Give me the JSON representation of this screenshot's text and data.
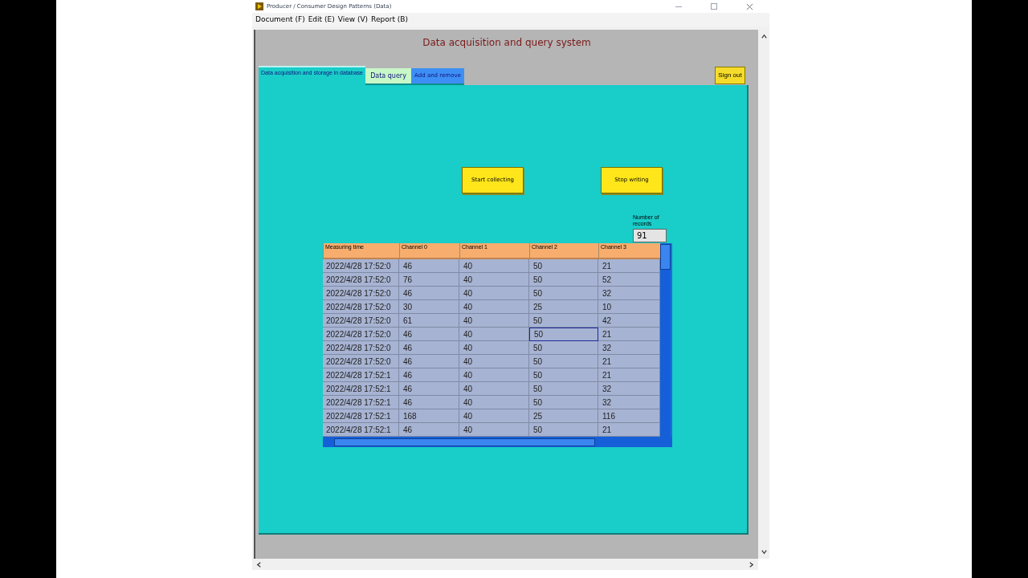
{
  "window": {
    "title": "Producer / Consumer Design Patterns (Data)"
  },
  "menu": [
    "Document (F)",
    "Edit (E)",
    "View (V)",
    "Report (B)"
  ],
  "panel": {
    "heading": "Data acquisition and query system"
  },
  "tabs": [
    {
      "label": "Data acquisition and storage in database",
      "selected": true,
      "color": "#19cdc9"
    },
    {
      "label": "Data query",
      "selected": false,
      "color": "#c8f7c8"
    },
    {
      "label": "Add and remove",
      "selected": false,
      "color": "#3d8ff5"
    }
  ],
  "sign_out": "Sign out",
  "buttons": [
    "Start collecting",
    "Stop writing"
  ],
  "records": {
    "label": "Number of records",
    "value": "91"
  },
  "table": {
    "columns": [
      "Measuring time",
      "Channel 0",
      "Channel 1",
      "Channel 2",
      "Channel 3"
    ],
    "rows": [
      {
        "cells": [
          "2022/4/28 17:52:0",
          "46",
          "40",
          "50",
          "21"
        ],
        "focused": [
          false,
          false,
          false,
          false,
          false
        ]
      },
      {
        "cells": [
          "2022/4/28 17:52:0",
          "76",
          "40",
          "50",
          "52"
        ],
        "focused": [
          false,
          false,
          false,
          false,
          false
        ]
      },
      {
        "cells": [
          "2022/4/28 17:52:0",
          "46",
          "40",
          "50",
          "32"
        ],
        "focused": [
          false,
          false,
          false,
          false,
          false
        ]
      },
      {
        "cells": [
          "2022/4/28 17:52:0",
          "30",
          "40",
          "25",
          "10"
        ],
        "focused": [
          false,
          false,
          false,
          false,
          false
        ]
      },
      {
        "cells": [
          "2022/4/28 17:52:0",
          "61",
          "40",
          "50",
          "42"
        ],
        "focused": [
          false,
          false,
          false,
          false,
          false
        ]
      },
      {
        "cells": [
          "2022/4/28 17:52:0",
          "46",
          "40",
          "50",
          "21"
        ],
        "focused": [
          false,
          false,
          false,
          true,
          false
        ]
      },
      {
        "cells": [
          "2022/4/28 17:52:0",
          "46",
          "40",
          "50",
          "32"
        ],
        "focused": [
          false,
          false,
          false,
          false,
          false
        ]
      },
      {
        "cells": [
          "2022/4/28 17:52:0",
          "46",
          "40",
          "50",
          "21"
        ],
        "focused": [
          false,
          false,
          false,
          false,
          false
        ]
      },
      {
        "cells": [
          "2022/4/28 17:52:1",
          "46",
          "40",
          "50",
          "21"
        ],
        "focused": [
          false,
          false,
          false,
          false,
          false
        ]
      },
      {
        "cells": [
          "2022/4/28 17:52:1",
          "46",
          "40",
          "50",
          "32"
        ],
        "focused": [
          false,
          false,
          false,
          false,
          false
        ]
      },
      {
        "cells": [
          "2022/4/28 17:52:1",
          "46",
          "40",
          "50",
          "32"
        ],
        "focused": [
          false,
          false,
          false,
          false,
          false
        ]
      },
      {
        "cells": [
          "2022/4/28 17:52:1",
          "168",
          "40",
          "25",
          "116"
        ],
        "focused": [
          false,
          false,
          false,
          false,
          false
        ]
      },
      {
        "cells": [
          "2022/4/28 17:52:1",
          "46",
          "40",
          "50",
          "21"
        ],
        "focused": [
          false,
          false,
          false,
          false,
          false
        ]
      }
    ]
  }
}
